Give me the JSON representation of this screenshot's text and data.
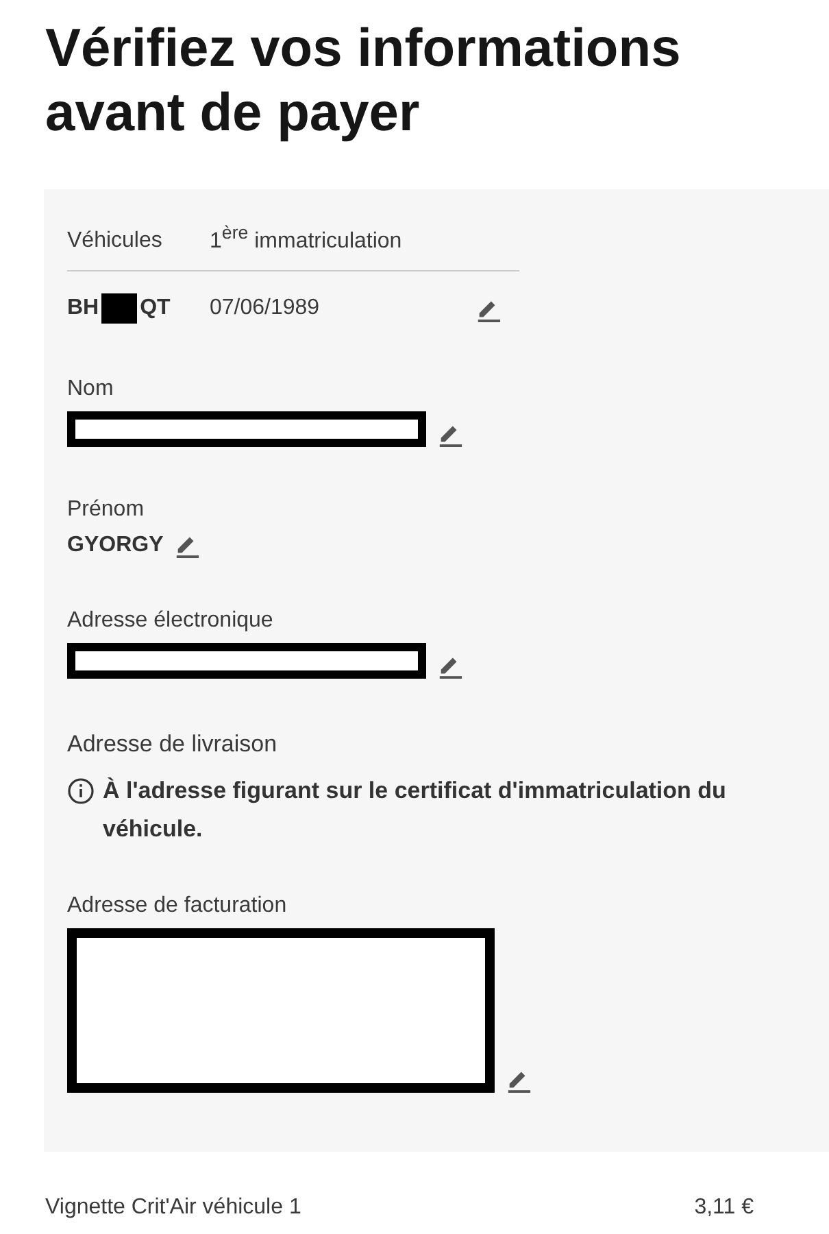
{
  "title": "Vérifiez vos informations avant de payer",
  "vehicles_table": {
    "columns": [
      "Véhicules",
      "1$^{ère}$ immatriculation"
    ],
    "rows": [
      {
        "plate_start": "BH",
        "plate_redacted": true,
        "plate_end": "QT",
        "date": "07/06/1989",
        "editable": true
      }
    ]
  },
  "fields": [
    {
      "kind": "text",
      "label": "Nom",
      "redacted": true,
      "editable": true
    },
    {
      "kind": "text",
      "label": "Prénom",
      "value": "GYORGY",
      "redacted": false,
      "editable": true
    },
    {
      "kind": "text",
      "label": "Adresse électronique",
      "redacted": true,
      "editable": true
    },
    {
      "kind": "info",
      "label": "Adresse de livraison",
      "value": "À l'adresse figurant sur le certificat d'immatriculation du véhicule."
    },
    {
      "kind": "block",
      "label": "Adresse de facturation",
      "redacted": true,
      "editable": true
    }
  ],
  "line_items": [
    {
      "label": "Vignette Crit'Air véhicule 1",
      "price": "3,11 €"
    }
  ]
}
